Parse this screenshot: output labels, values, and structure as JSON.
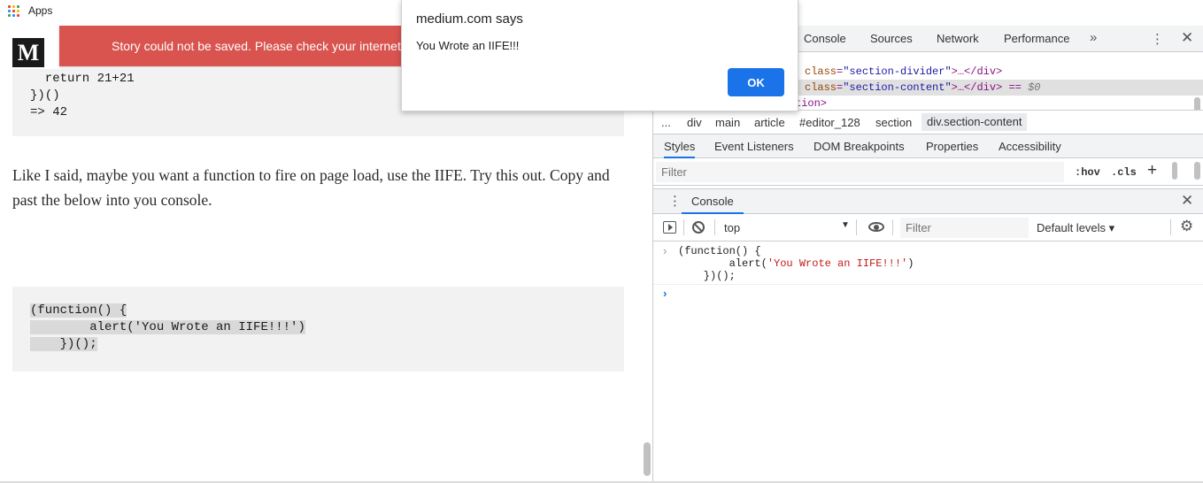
{
  "bookmarks": {
    "apps_label": "Apps",
    "apps_icon": "apps-grid-icon",
    "apps_colors": [
      "#ea4335",
      "#fbbc05",
      "#34a853",
      "#4285f4",
      "#ea4335",
      "#fbbc05",
      "#34a853",
      "#4285f4",
      "#ea4335"
    ]
  },
  "page": {
    "logo_letter": "M",
    "toast_text": "Story could not be saved. Please check your internet",
    "code1_lines": [
      "  return 21+21",
      "})()",
      "=> 42"
    ],
    "paragraph": "Like I said, maybe you want a function to fire on page load, use the IIFE. Try this out. Copy and past the below into you console.",
    "code2_lines": [
      "(function() {",
      "        alert('You Wrote an IIFE!!!')",
      "    })();"
    ]
  },
  "dialog": {
    "title": "medium.com says",
    "message": "You Wrote an IIFE!!!",
    "ok_label": "OK",
    "ok_color": "#1a73e8"
  },
  "devtools": {
    "tabs": [
      "Console",
      "Sources",
      "Network",
      "Performance"
    ],
    "more_icon": "double-chevron-icon",
    "elements": {
      "line1": "                                                                  ",
      "line2_attr": "class",
      "line2_val": "\"section-divider\"",
      "line2_rest": ">…</div>",
      "line3_attr": "class",
      "line3_val": "\"section-content\"",
      "line3_rest": ">…</div> == ",
      "line3_dollar": "$0",
      "line4_tail": "tion>"
    },
    "breadcrumb": [
      "...",
      "div",
      "main",
      "article",
      "#editor_128",
      "section",
      "div.section-content"
    ],
    "subtabs": [
      "Styles",
      "Event Listeners",
      "DOM Breakpoints",
      "Properties",
      "Accessibility"
    ],
    "styles_filter_placeholder": "Filter",
    "hov_label": ":hov",
    "cls_label": ".cls",
    "plus_label": "+",
    "drawer_tab": "Console",
    "console_context": "top",
    "console_filter_placeholder": "Filter",
    "levels_label": "Default levels",
    "console_input": {
      "line1": "(function() {",
      "line2_prefix": "        alert(",
      "line2_string": "'You Wrote an IIFE!!!'",
      "line2_suffix": ")",
      "line3": "    })();"
    },
    "accent_color": "#1a73e8"
  }
}
